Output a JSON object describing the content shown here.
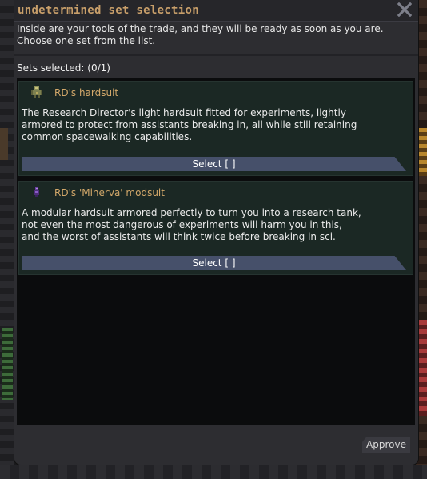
{
  "window": {
    "title": "undetermined set selection",
    "close_icon": "close-icon"
  },
  "intro": {
    "line1": "Inside are your tools of the trade, and they will be ready as soon as you are.",
    "line2": "Choose one set from the list."
  },
  "sets_selected_label": "Sets selected: (0/1)",
  "sets": [
    {
      "icon": "hardsuit-icon",
      "name": "RD's hardsuit",
      "description_lines": [
        "The Research Director's light hardsuit fitted for experiments, lightly",
        "armored to protect from assistants breaking in, all while still retaining",
        "common spacewalking capabilities."
      ],
      "select_label": "Select [  ]"
    },
    {
      "icon": "modsuit-icon",
      "name": "RD's 'Minerva' modsuit",
      "description_lines": [
        "A modular hardsuit armored perfectly to turn you into a research tank,",
        "not even the most dangerous of experiments will harm you in this,",
        "and the worst of assistants will think twice before breaking in sci."
      ],
      "select_label": "Select [  ]"
    }
  ],
  "footer": {
    "approve_label": "Approve"
  },
  "colors": {
    "title": "#c89f6a",
    "set_name": "#d3a86a",
    "card_bg": "#1b2824",
    "button_bg": "#46506a"
  }
}
